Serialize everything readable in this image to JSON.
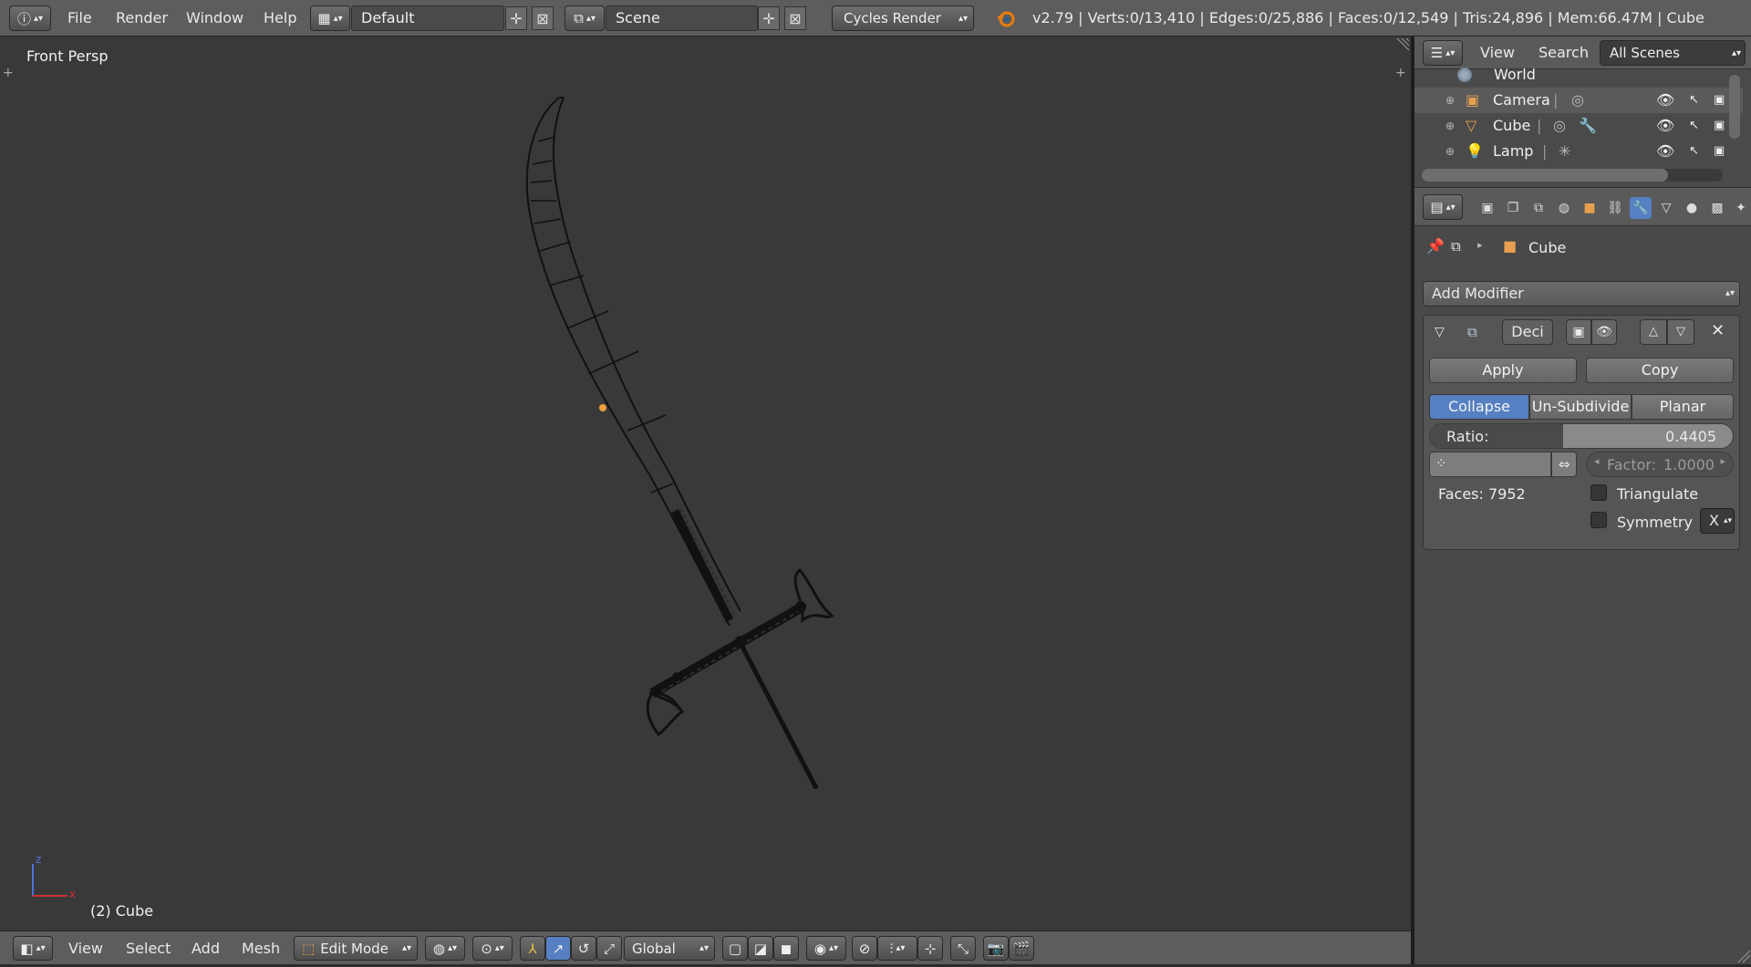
{
  "topbar": {
    "menus": [
      "File",
      "Render",
      "Window",
      "Help"
    ],
    "layout_name": "Default",
    "scene_name": "Scene",
    "render_engine": "Cycles Render",
    "stats": "v2.79 | Verts:0/13,410 | Edges:0/25,886 | Faces:0/12,549 | Tris:24,896 | Mem:66.47M | Cube",
    "icons": [
      "info-icon",
      "screen-layout-icon",
      "add-icon",
      "close-icon",
      "scene-icon",
      "blender-logo-icon"
    ]
  },
  "viewport": {
    "view_label": "Front Persp",
    "object_label": "(2) Cube",
    "axis_labels": {
      "x": "x",
      "z": "z"
    }
  },
  "bottombar": {
    "menus": [
      "View",
      "Select",
      "Add",
      "Mesh"
    ],
    "mode": "Edit Mode",
    "orientation": "Global",
    "icons": [
      "editor-type-icon",
      "pivot-icon",
      "manipulator-icon",
      "translate-icon",
      "rotate-icon",
      "scale-icon",
      "vertex-select-icon",
      "edge-select-icon",
      "face-select-icon",
      "proportional-edit-icon",
      "snap-icon",
      "render-icon"
    ]
  },
  "outliner": {
    "view_menu": "View",
    "search_menu": "Search",
    "filter": "All Scenes",
    "items": [
      {
        "name": "World",
        "icon": "world-icon"
      },
      {
        "name": "Camera",
        "icon": "camera-icon"
      },
      {
        "name": "Cube",
        "icon": "mesh-icon"
      },
      {
        "name": "Lamp",
        "icon": "lamp-icon"
      }
    ]
  },
  "properties": {
    "breadcrumb_object": "Cube",
    "add_modifier_label": "Add Modifier",
    "modifier": {
      "name": "Deci",
      "apply_label": "Apply",
      "copy_label": "Copy",
      "modes": [
        "Collapse",
        "Un-Subdivide",
        "Planar"
      ],
      "active_mode": "Collapse",
      "ratio_label": "Ratio:",
      "ratio_value": "0.4405",
      "ratio_fraction": 0.4405,
      "factor_label": "Factor:",
      "factor_value": "1.0000",
      "faces_text": "Faces: 7952",
      "triangulate_label": "Triangulate",
      "symmetry_label": "Symmetry",
      "symmetry_axis": "X"
    }
  },
  "colors": {
    "accent": "#5680c2",
    "header": "#5d5d5d",
    "viewport_bg": "#393939",
    "selected_vertex": "#f0a040"
  }
}
